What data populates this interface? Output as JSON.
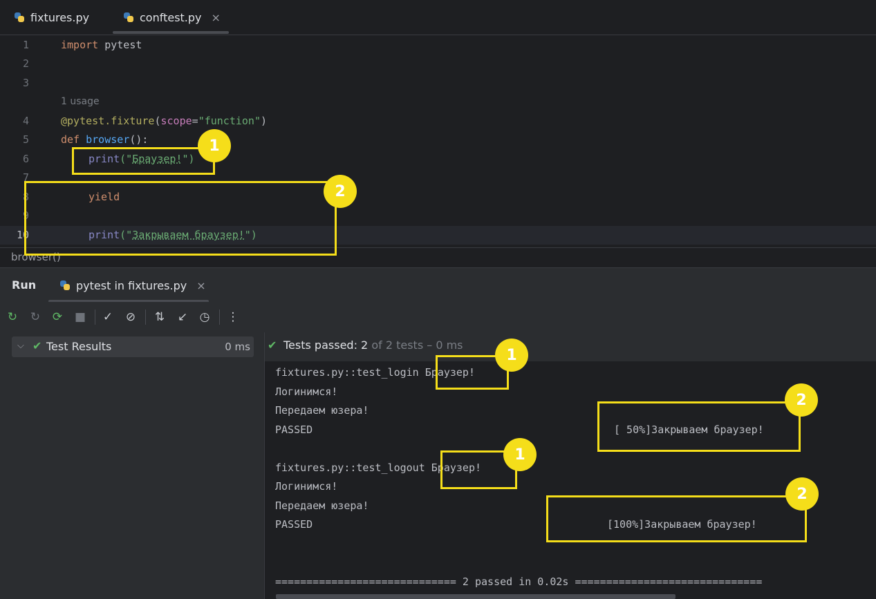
{
  "tabs": [
    {
      "label": "fixtures.py",
      "active": false
    },
    {
      "label": "conftest.py",
      "active": true,
      "close": "×"
    }
  ],
  "editor": {
    "usage_hint": "1 usage",
    "line_numbers": [
      "1",
      "2",
      "3",
      "4",
      "5",
      "6",
      "7",
      "8",
      "9",
      "10"
    ],
    "lines": {
      "l1_kw": "import",
      "l1_rest": " pytest",
      "l4_dec": "@pytest.fixture",
      "l4_open": "(",
      "l4_param": "scope",
      "l4_eq": "=",
      "l4_str": "\"function\"",
      "l4_close": ")",
      "l5_kw": "def",
      "l5_fn": "browser",
      "l5_rest": "():",
      "l6_print": "print",
      "l6_open": "(\"",
      "l6_str": "Браузер!",
      "l6_close": "\")",
      "l8_kw": "yield",
      "l10_print": "print",
      "l10_open": "(\"",
      "l10_str": "Закрываем браузер!",
      "l10_close": "\")"
    },
    "breadcrumb": "browser()"
  },
  "run_panel": {
    "title": "Run",
    "tab_label": "pytest in fixtures.py",
    "tab_close": "×",
    "tree": {
      "label": "Test Results",
      "time": "0 ms"
    },
    "status": {
      "prefix": "Tests passed: ",
      "count": "2",
      "suffix": " of 2 tests – 0 ms"
    },
    "console": [
      "fixtures.py::test_login Браузер!",
      "Логинимся!",
      "Передаем юзера!",
      "PASSED",
      "[ 50%]Закрываем браузер!",
      "fixtures.py::test_logout Браузер!",
      "Логинимся!",
      "Передаем юзера!",
      "PASSED",
      "[100%]Закрываем браузер!",
      "============================= 2 passed in 0.02s =============================="
    ]
  },
  "annotations": [
    "1",
    "2",
    "1",
    "2",
    "1",
    "2"
  ],
  "colors": {
    "annotation": "#f5de1a",
    "success": "#5fb865",
    "keyword": "#cf8e6d",
    "string": "#6aab73"
  }
}
